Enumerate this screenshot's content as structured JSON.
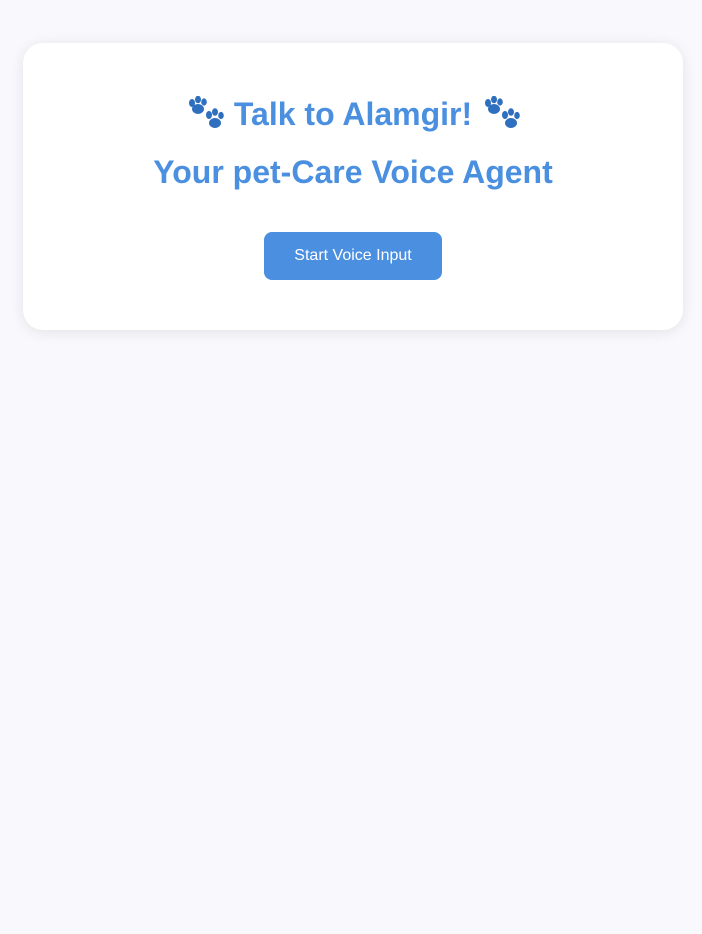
{
  "header": {
    "title": "Talk to Alamgir!",
    "subtitle": "Your pet-Care Voice Agent",
    "left_icon": "paw-prints-icon",
    "right_icon": "paw-prints-icon"
  },
  "actions": {
    "start_voice_label": "Start Voice Input"
  },
  "colors": {
    "accent": "#4a8fe0",
    "paw": "#2f6fbf",
    "background": "#f8f8fd",
    "card": "#ffffff"
  }
}
